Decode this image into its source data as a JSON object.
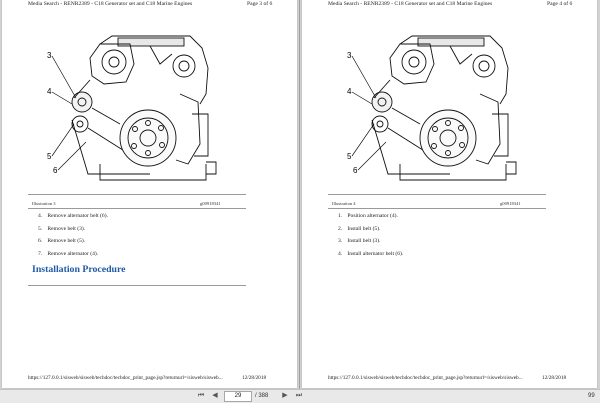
{
  "pages": [
    {
      "header_left": "Media Search - RENR2389 - C18 Generator set and C18 Marine Engines",
      "header_right": "Page 3 of 6",
      "callouts": [
        "3",
        "4",
        "5",
        "6"
      ],
      "caption": "Illustration 3",
      "figure_id": "g00918341",
      "steps": [
        {
          "num": "4.",
          "text": "Remove alternator belt (6)."
        },
        {
          "num": "5.",
          "text": "Remove belt (3)."
        },
        {
          "num": "6.",
          "text": "Remove belt (5)."
        },
        {
          "num": "7.",
          "text": "Remove alternator (4)."
        }
      ],
      "section_title": "Installation Procedure",
      "footer_url": "https://127.0.0.1/sisweb/sisweb/techdoc/techdoc_print_page.jsp?returnurl=/sisweb/sisweb...",
      "footer_date": "12/28/2018"
    },
    {
      "header_left": "Media Search - RENR2389 - C18 Generator set and C18 Marine Engines",
      "header_right": "Page 4 of 6",
      "callouts": [
        "3",
        "4",
        "5",
        "6"
      ],
      "caption": "Illustration 4",
      "figure_id": "g00918341",
      "steps": [
        {
          "num": "1.",
          "text": "Position alternator (4)."
        },
        {
          "num": "2.",
          "text": "Install belt (5)."
        },
        {
          "num": "3.",
          "text": "Install belt (3)."
        },
        {
          "num": "4.",
          "text": "Install alternator belt (6)."
        }
      ],
      "footer_url": "https://127.0.0.1/sisweb/sisweb/techdoc/techdoc_print_page.jsp?returnurl=/sisweb/sisweb...",
      "footer_date": "12/28/2018"
    }
  ],
  "toolbar": {
    "current_page": "29",
    "total_pages": "/ 388",
    "zoom": "99",
    "icons": [
      "first-page-icon",
      "previous-page-icon",
      "next-page-icon",
      "last-page-icon"
    ]
  }
}
